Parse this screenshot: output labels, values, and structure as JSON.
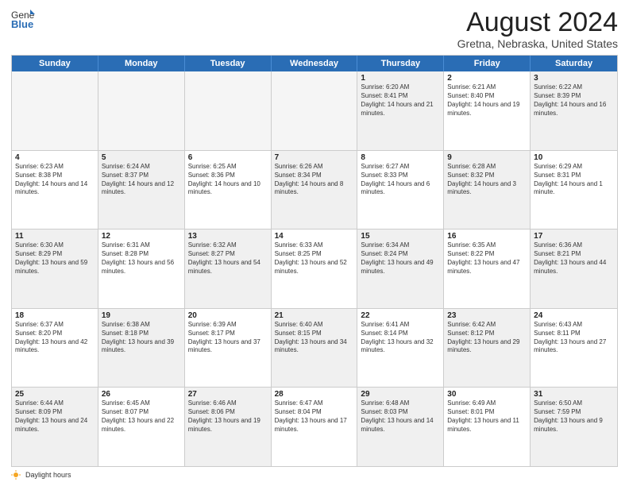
{
  "header": {
    "logo_line1": "General",
    "logo_line2": "Blue",
    "month_year": "August 2024",
    "location": "Gretna, Nebraska, United States"
  },
  "days_of_week": [
    "Sunday",
    "Monday",
    "Tuesday",
    "Wednesday",
    "Thursday",
    "Friday",
    "Saturday"
  ],
  "weeks": [
    [
      {
        "day": "",
        "empty": true
      },
      {
        "day": "",
        "empty": true
      },
      {
        "day": "",
        "empty": true
      },
      {
        "day": "",
        "empty": true
      },
      {
        "day": "1",
        "sunrise": "Sunrise: 6:20 AM",
        "sunset": "Sunset: 8:41 PM",
        "daylight": "Daylight: 14 hours and 21 minutes."
      },
      {
        "day": "2",
        "sunrise": "Sunrise: 6:21 AM",
        "sunset": "Sunset: 8:40 PM",
        "daylight": "Daylight: 14 hours and 19 minutes."
      },
      {
        "day": "3",
        "sunrise": "Sunrise: 6:22 AM",
        "sunset": "Sunset: 8:39 PM",
        "daylight": "Daylight: 14 hours and 16 minutes."
      }
    ],
    [
      {
        "day": "4",
        "sunrise": "Sunrise: 6:23 AM",
        "sunset": "Sunset: 8:38 PM",
        "daylight": "Daylight: 14 hours and 14 minutes."
      },
      {
        "day": "5",
        "sunrise": "Sunrise: 6:24 AM",
        "sunset": "Sunset: 8:37 PM",
        "daylight": "Daylight: 14 hours and 12 minutes."
      },
      {
        "day": "6",
        "sunrise": "Sunrise: 6:25 AM",
        "sunset": "Sunset: 8:36 PM",
        "daylight": "Daylight: 14 hours and 10 minutes."
      },
      {
        "day": "7",
        "sunrise": "Sunrise: 6:26 AM",
        "sunset": "Sunset: 8:34 PM",
        "daylight": "Daylight: 14 hours and 8 minutes."
      },
      {
        "day": "8",
        "sunrise": "Sunrise: 6:27 AM",
        "sunset": "Sunset: 8:33 PM",
        "daylight": "Daylight: 14 hours and 6 minutes."
      },
      {
        "day": "9",
        "sunrise": "Sunrise: 6:28 AM",
        "sunset": "Sunset: 8:32 PM",
        "daylight": "Daylight: 14 hours and 3 minutes."
      },
      {
        "day": "10",
        "sunrise": "Sunrise: 6:29 AM",
        "sunset": "Sunset: 8:31 PM",
        "daylight": "Daylight: 14 hours and 1 minute."
      }
    ],
    [
      {
        "day": "11",
        "sunrise": "Sunrise: 6:30 AM",
        "sunset": "Sunset: 8:29 PM",
        "daylight": "Daylight: 13 hours and 59 minutes."
      },
      {
        "day": "12",
        "sunrise": "Sunrise: 6:31 AM",
        "sunset": "Sunset: 8:28 PM",
        "daylight": "Daylight: 13 hours and 56 minutes."
      },
      {
        "day": "13",
        "sunrise": "Sunrise: 6:32 AM",
        "sunset": "Sunset: 8:27 PM",
        "daylight": "Daylight: 13 hours and 54 minutes."
      },
      {
        "day": "14",
        "sunrise": "Sunrise: 6:33 AM",
        "sunset": "Sunset: 8:25 PM",
        "daylight": "Daylight: 13 hours and 52 minutes."
      },
      {
        "day": "15",
        "sunrise": "Sunrise: 6:34 AM",
        "sunset": "Sunset: 8:24 PM",
        "daylight": "Daylight: 13 hours and 49 minutes."
      },
      {
        "day": "16",
        "sunrise": "Sunrise: 6:35 AM",
        "sunset": "Sunset: 8:22 PM",
        "daylight": "Daylight: 13 hours and 47 minutes."
      },
      {
        "day": "17",
        "sunrise": "Sunrise: 6:36 AM",
        "sunset": "Sunset: 8:21 PM",
        "daylight": "Daylight: 13 hours and 44 minutes."
      }
    ],
    [
      {
        "day": "18",
        "sunrise": "Sunrise: 6:37 AM",
        "sunset": "Sunset: 8:20 PM",
        "daylight": "Daylight: 13 hours and 42 minutes."
      },
      {
        "day": "19",
        "sunrise": "Sunrise: 6:38 AM",
        "sunset": "Sunset: 8:18 PM",
        "daylight": "Daylight: 13 hours and 39 minutes."
      },
      {
        "day": "20",
        "sunrise": "Sunrise: 6:39 AM",
        "sunset": "Sunset: 8:17 PM",
        "daylight": "Daylight: 13 hours and 37 minutes."
      },
      {
        "day": "21",
        "sunrise": "Sunrise: 6:40 AM",
        "sunset": "Sunset: 8:15 PM",
        "daylight": "Daylight: 13 hours and 34 minutes."
      },
      {
        "day": "22",
        "sunrise": "Sunrise: 6:41 AM",
        "sunset": "Sunset: 8:14 PM",
        "daylight": "Daylight: 13 hours and 32 minutes."
      },
      {
        "day": "23",
        "sunrise": "Sunrise: 6:42 AM",
        "sunset": "Sunset: 8:12 PM",
        "daylight": "Daylight: 13 hours and 29 minutes."
      },
      {
        "day": "24",
        "sunrise": "Sunrise: 6:43 AM",
        "sunset": "Sunset: 8:11 PM",
        "daylight": "Daylight: 13 hours and 27 minutes."
      }
    ],
    [
      {
        "day": "25",
        "sunrise": "Sunrise: 6:44 AM",
        "sunset": "Sunset: 8:09 PM",
        "daylight": "Daylight: 13 hours and 24 minutes."
      },
      {
        "day": "26",
        "sunrise": "Sunrise: 6:45 AM",
        "sunset": "Sunset: 8:07 PM",
        "daylight": "Daylight: 13 hours and 22 minutes."
      },
      {
        "day": "27",
        "sunrise": "Sunrise: 6:46 AM",
        "sunset": "Sunset: 8:06 PM",
        "daylight": "Daylight: 13 hours and 19 minutes."
      },
      {
        "day": "28",
        "sunrise": "Sunrise: 6:47 AM",
        "sunset": "Sunset: 8:04 PM",
        "daylight": "Daylight: 13 hours and 17 minutes."
      },
      {
        "day": "29",
        "sunrise": "Sunrise: 6:48 AM",
        "sunset": "Sunset: 8:03 PM",
        "daylight": "Daylight: 13 hours and 14 minutes."
      },
      {
        "day": "30",
        "sunrise": "Sunrise: 6:49 AM",
        "sunset": "Sunset: 8:01 PM",
        "daylight": "Daylight: 13 hours and 11 minutes."
      },
      {
        "day": "31",
        "sunrise": "Sunrise: 6:50 AM",
        "sunset": "Sunset: 7:59 PM",
        "daylight": "Daylight: 13 hours and 9 minutes."
      }
    ]
  ],
  "legend": {
    "daylight_label": "Daylight hours"
  }
}
